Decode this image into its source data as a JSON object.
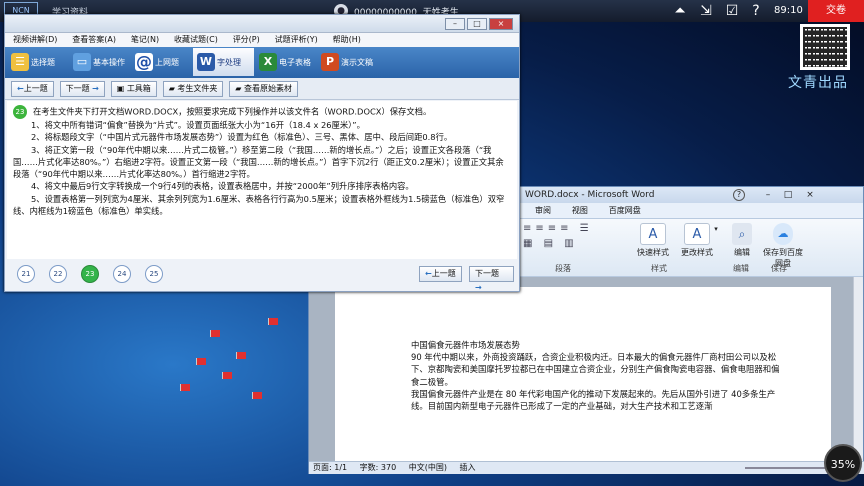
{
  "topbar": {
    "logo": "NCN",
    "app_title": "学习资料",
    "user": "00000000000",
    "user_label": "无姓考生",
    "time": "89:10",
    "submit": "交卷",
    "icons": [
      "double-chevron-up-icon",
      "pin-icon",
      "checklist-icon",
      "help-icon",
      "menu-icon"
    ]
  },
  "brand": "文青出品",
  "exam": {
    "menu": [
      "视频讲解(D)",
      "查看答案(A)",
      "笔记(N)",
      "收藏试题(C)",
      "评分(P)",
      "试题评析(Y)",
      "帮助(H)"
    ],
    "modes": [
      {
        "label": "选择题",
        "icon": "list-icon",
        "color": "#f0c040"
      },
      {
        "label": "基本操作",
        "icon": "computer-icon",
        "color": "#60a0e0"
      },
      {
        "label": "上网题",
        "icon": "at-icon",
        "color": "#1f4fa8"
      },
      {
        "label": "字处理",
        "icon": "word-icon",
        "color": "#2a5aa8"
      },
      {
        "label": "电子表格",
        "icon": "excel-icon",
        "color": "#2a8a3a"
      },
      {
        "label": "演示文稿",
        "icon": "ppt-icon",
        "color": "#d04a20"
      }
    ],
    "nav": {
      "prev": "上一题",
      "next": "下一题",
      "tools": "工具箱",
      "student_folder": "考生文件夹",
      "view_source": "查看原始素材"
    },
    "question_number": "23",
    "instructions": [
      "在考生文件夹下打开文档WORD.DOCX，按照要求完成下列操作并以该文件名（WORD.DOCX）保存文档。",
      "1、将文中所有错词“偏食”替换为“片式”。设置页面纸张大小为“16开（18.4 x 26厘米）”。",
      "2、将标题段文字（“中国片式元器件市场发展态势”）设置为红色（标准色）、三号、黑体、居中、段后间距0.8行。",
      "3、将正文第一段（“90年代中期以来……片式二极管。”）移至第二段（“我国……新的增长点。”）之后；设置正文各段落（“我国……片式化率达80%。”）右缩进2字符。设置正文第一段（“我国……新的增长点。”）首字下沉2行（距正文0.2厘米）；设置正文其余段落（“90年代中期以来……片式化率达80%。）首行缩进2字符。",
      "4、将文中最后9行文字转换成一个9行4列的表格，设置表格居中，并按“2000年”列升序排序表格内容。",
      "5、设置表格第一列列宽为4厘米、其余列列宽为1.6厘米、表格各行行高为0.5厘米；设置表格外框线为1.5磅蓝色（标准色）双窄线、内框线为1磅蓝色（标准色）单实线。"
    ],
    "pages": [
      "21",
      "22",
      "23",
      "24",
      "25"
    ],
    "current_page": "23",
    "window_buttons": [
      "–",
      "□",
      "×"
    ]
  },
  "word": {
    "title": "WORD.docx - Microsoft Word",
    "tabs": [
      "审阅",
      "视图",
      "百度网盘"
    ],
    "ribbon": {
      "group_paragraph": "段落",
      "group_styles": "样式",
      "group_edit": "编辑",
      "group_save": "保存",
      "quick_styles": "快速样式",
      "change_styles": "更改样式",
      "edit": "编辑",
      "save_baidu": "保存到百度网盘"
    },
    "doc_lines": [
      "中国偏食元器件市场发展态势",
      "90 年代中期以来，外商投资踊跃，合资企业积极内迁。日本最大的偏食元器件厂商村田公司以及松下、京都陶瓷和美国摩托罗拉都已在中国建立合资企业，分别生产偏食陶瓷电容器、偏食电阻器和偏食二极管。",
      "我国偏食元器件产业是在 80 年代彩电国产化的推动下发展起来的。先后从国外引进了 40多条生产线。目前国内新型电子元器件已形成了一定的产业基础，对大生产技术和工艺逐渐"
    ],
    "status": {
      "page": "页面: 1/1",
      "words": "字数: 370",
      "lang": "中文(中国)",
      "mode": "插入"
    }
  },
  "zoom": "35%"
}
